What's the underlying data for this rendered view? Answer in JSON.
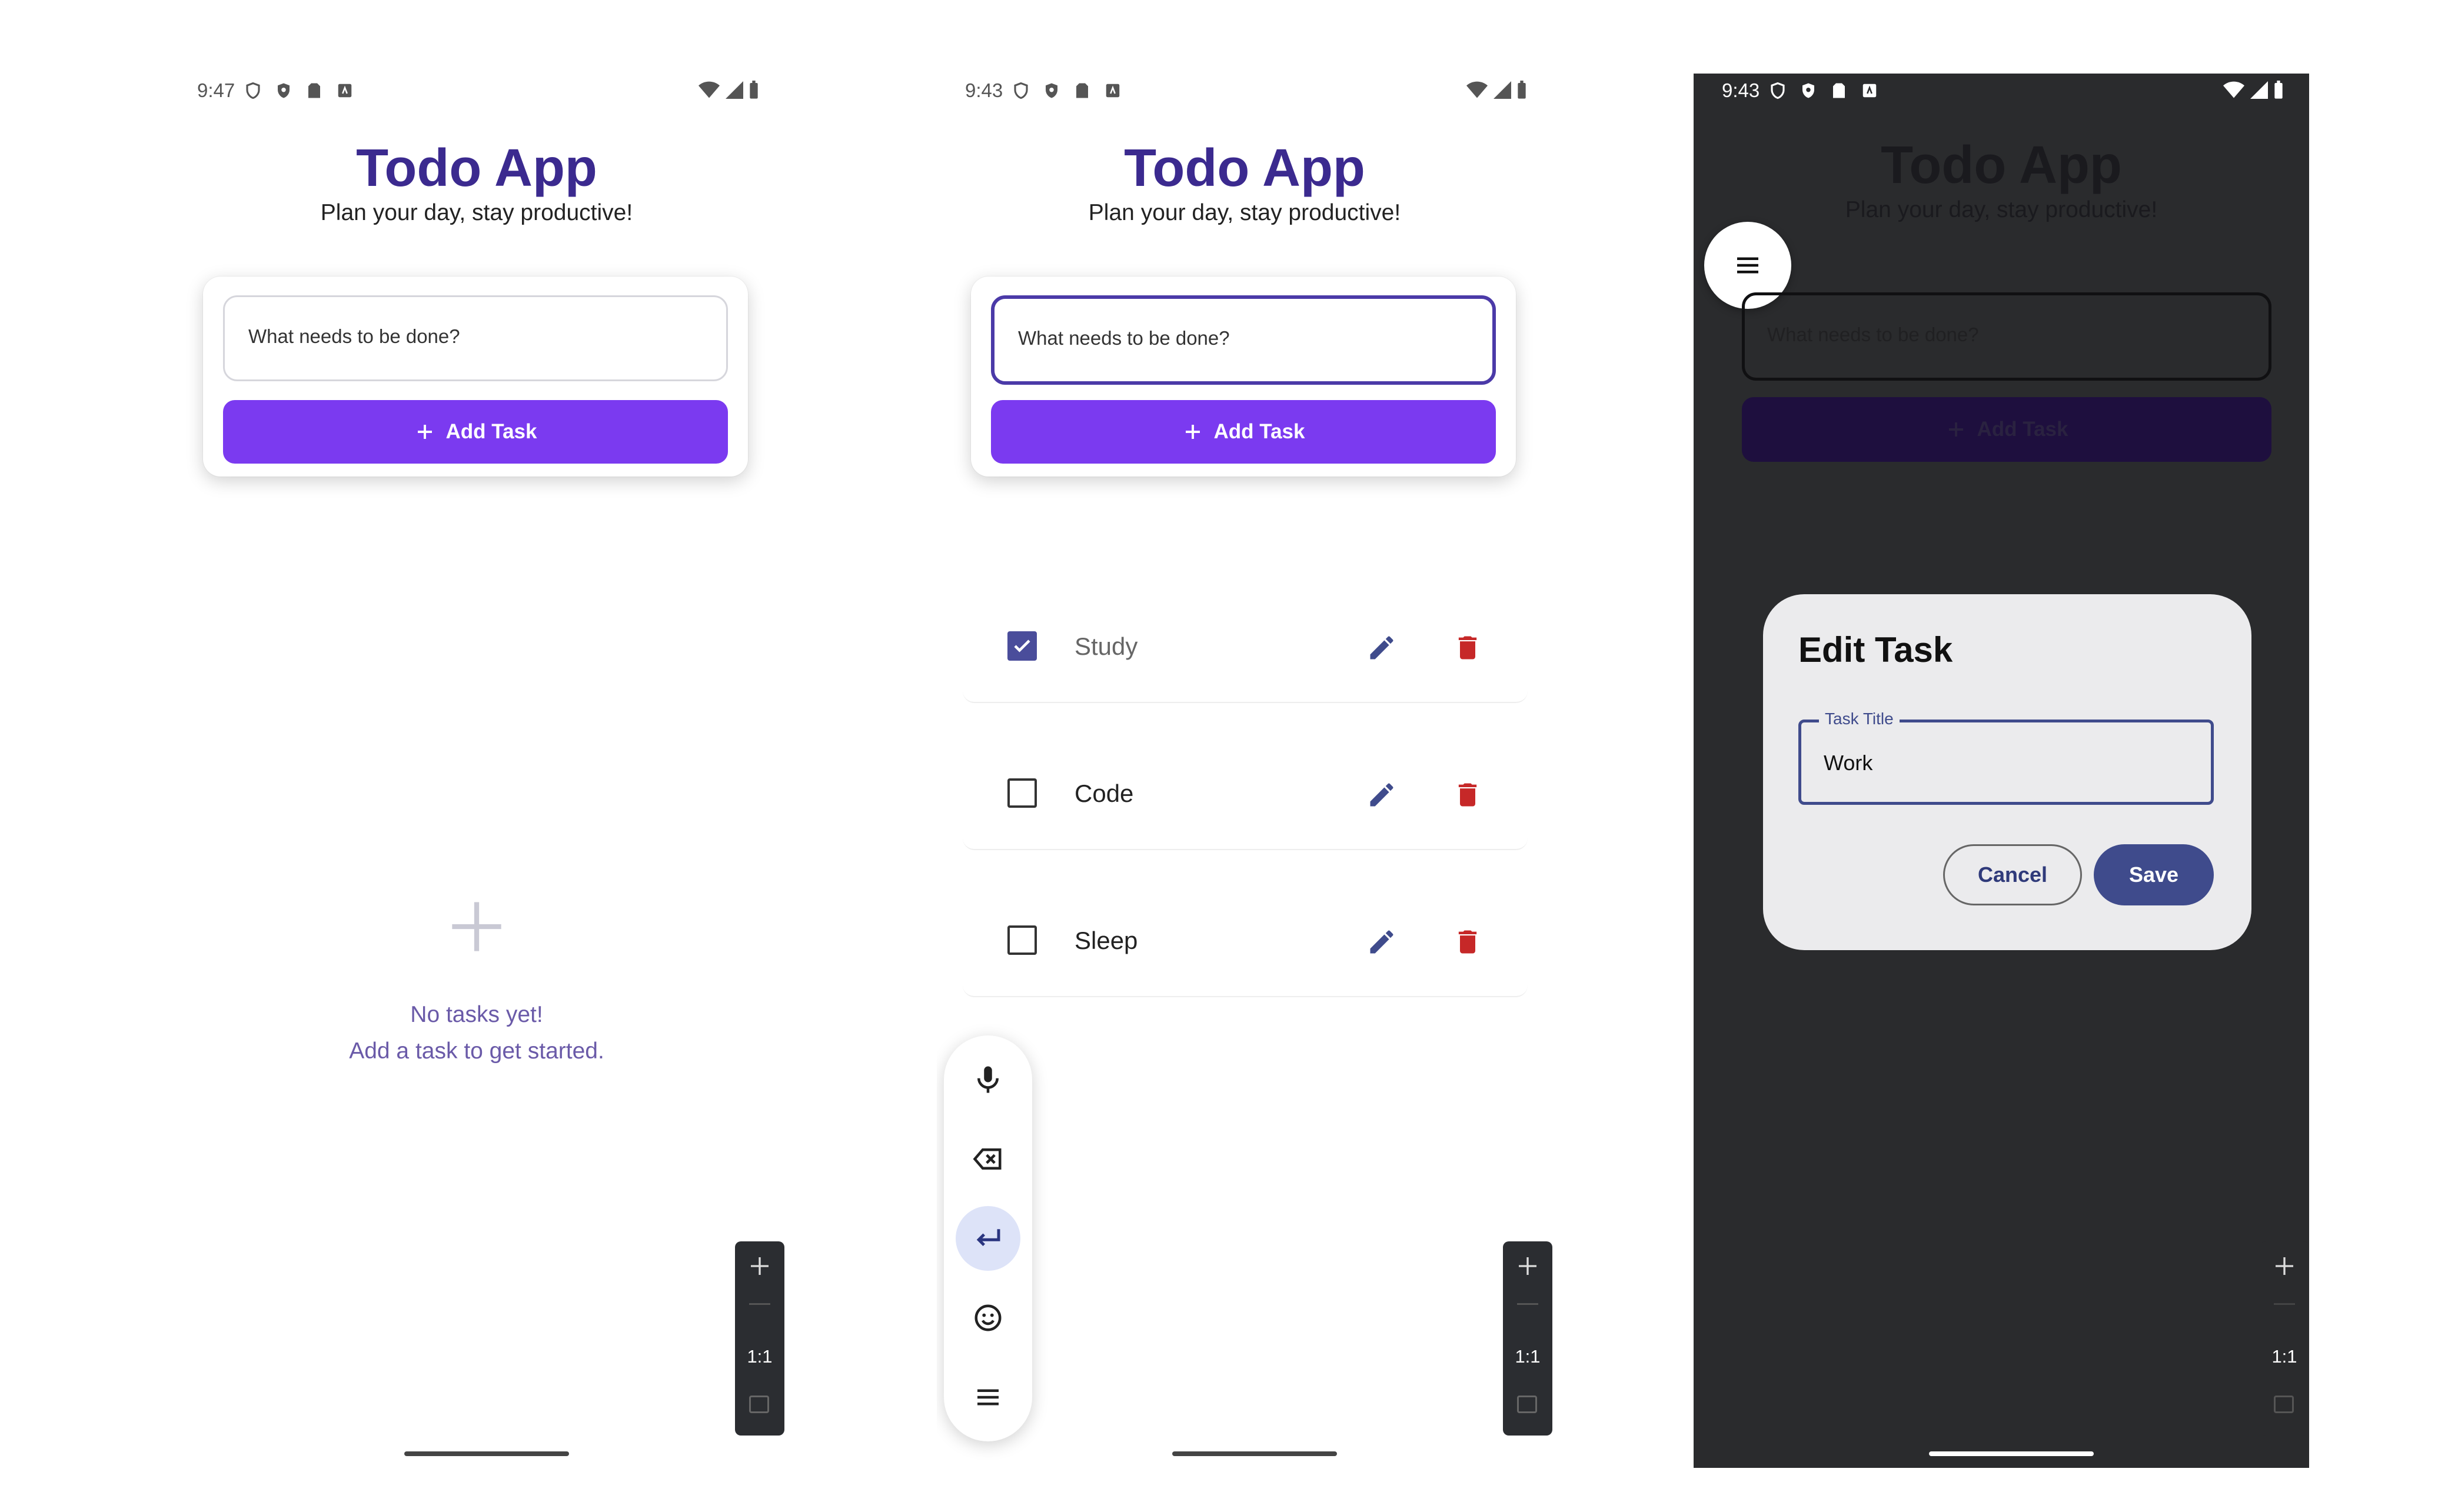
{
  "screen_empty": {
    "status": {
      "time": "9:47"
    },
    "header": {
      "title": "Todo App",
      "subtitle": "Plan your day, stay productive!"
    },
    "new_task": {
      "placeholder": "What needs to be done?",
      "add_label": "Add Task"
    },
    "empty_state": {
      "line1": "No tasks yet!",
      "line2": "Add a task to get started."
    },
    "zoom": {
      "ratio": "1:1"
    }
  },
  "screen_list": {
    "status": {
      "time": "9:43"
    },
    "header": {
      "title": "Todo App",
      "subtitle": "Plan your day, stay productive!"
    },
    "new_task": {
      "placeholder": "What needs to be done?",
      "add_label": "Add Task"
    },
    "tasks": [
      {
        "label": "Study",
        "checked": true
      },
      {
        "label": "Code",
        "checked": false
      },
      {
        "label": "Sleep",
        "checked": false
      }
    ],
    "zoom": {
      "ratio": "1:1"
    }
  },
  "screen_edit": {
    "status": {
      "time": "9:43"
    },
    "header": {
      "title": "Todo App",
      "subtitle": "Plan your day, stay productive!"
    },
    "new_task": {
      "placeholder": "What needs to be done?",
      "add_label": "Add Task"
    },
    "dialog": {
      "title": "Edit Task",
      "field_label": "Task Title",
      "field_value": "Work",
      "cancel_label": "Cancel",
      "save_label": "Save"
    },
    "zoom": {
      "ratio": "1:1"
    }
  },
  "colors": {
    "title": "#3b2a8f",
    "accent": "#7b3af0",
    "dialog_primary": "#3f4b8c",
    "delete": "#c62828",
    "edit": "#3f4b8c",
    "empty_text": "#6a5aa8"
  }
}
